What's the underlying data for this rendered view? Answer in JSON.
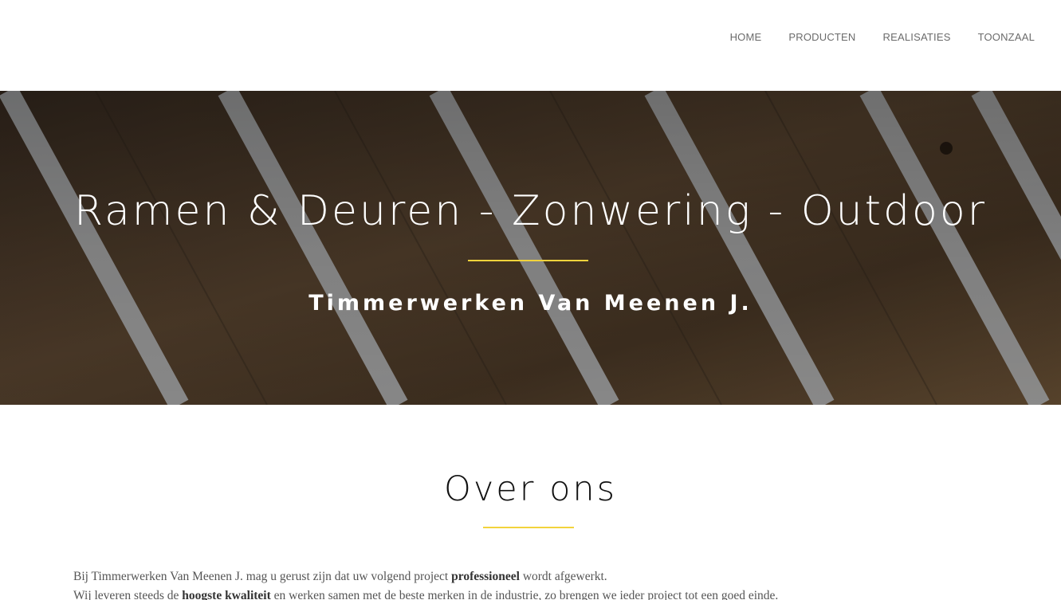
{
  "nav": {
    "items": [
      {
        "label": "HOME"
      },
      {
        "label": "PRODUCTEN"
      },
      {
        "label": "REALISATIES"
      },
      {
        "label": "TOONZAAL"
      }
    ]
  },
  "hero": {
    "title": "Ramen & Deuren - Zonwering - Outdoor",
    "subtitle": "Timmerwerken Van Meenen J."
  },
  "about": {
    "title": "Over ons",
    "line1": {
      "pre": "Bij Timmerwerken Van Meenen J. mag u gerust zijn dat uw volgend project ",
      "bold": "professioneel",
      "post": " wordt afgewerkt."
    },
    "line2": {
      "pre": "Wij leveren steeds de ",
      "bold": "hoogste kwaliteit",
      "post": " en werken samen met de beste merken in de industrie, zo brengen we ieder project tot een goed einde."
    }
  },
  "colors": {
    "accent": "#f2d33c",
    "nav_text": "#6b6b6b",
    "hero_overlay": "#1e1712"
  }
}
